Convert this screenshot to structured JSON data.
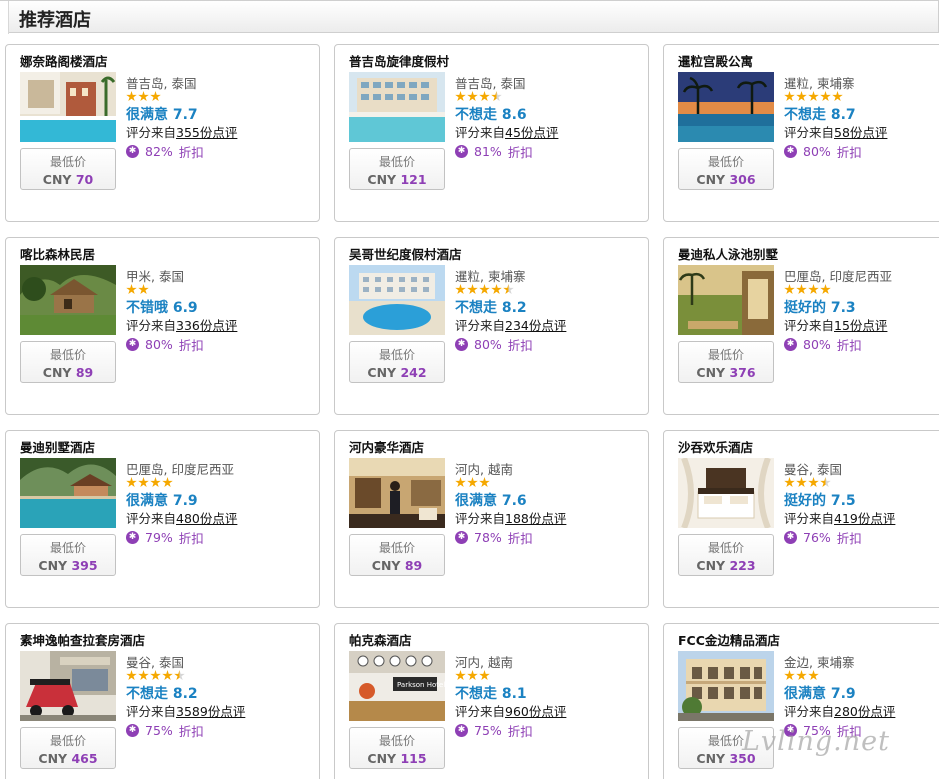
{
  "section": {
    "title": "推荐酒店"
  },
  "labels": {
    "review_prefix": "评分来自",
    "price_label": "最低价",
    "currency": "CNY",
    "discount_suffix": "折扣"
  },
  "colors": {
    "rating": "#1b82c2",
    "discount": "#8e3fb5",
    "star": "#f5a800"
  },
  "hotels": [
    {
      "name": "娜奈路阁楼酒店",
      "location": "普吉岛, 泰国",
      "stars": 3,
      "rating_text": "很满意",
      "rating": "7.7",
      "reviews": "355份点评",
      "discount": "82%",
      "price": "70",
      "image": "pool-resort"
    },
    {
      "name": "普吉岛旋律度假村",
      "location": "普吉岛, 泰国",
      "stars": 3.5,
      "rating_text": "不想走",
      "rating": "8.6",
      "reviews": "45份点评",
      "discount": "81%",
      "price": "121",
      "image": "hotel-pool"
    },
    {
      "name": "暹粒宫殿公寓",
      "location": "暹粒, 柬埔寨",
      "stars": 5,
      "rating_text": "不想走",
      "rating": "8.7",
      "reviews": "58份点评",
      "discount": "80%",
      "price": "306",
      "image": "palm-pool-night"
    },
    {
      "name": "喀比森林民居",
      "location": "甲米, 泰国",
      "stars": 2,
      "rating_text": "不错哦",
      "rating": "6.9",
      "reviews": "336份点评",
      "discount": "80%",
      "price": "89",
      "image": "forest-house"
    },
    {
      "name": "吴哥世纪度假村酒店",
      "location": "暹粒, 柬埔寨",
      "stars": 4.5,
      "rating_text": "不想走",
      "rating": "8.2",
      "reviews": "234份点评",
      "discount": "80%",
      "price": "242",
      "image": "round-pool"
    },
    {
      "name": "曼迪私人泳池别墅",
      "location": "巴厘岛, 印度尼西亚",
      "stars": 4,
      "rating_text": "挺好的",
      "rating": "7.3",
      "reviews": "15份点评",
      "discount": "80%",
      "price": "376",
      "image": "villa-field"
    },
    {
      "name": "曼迪别墅酒店",
      "location": "巴厘岛, 印度尼西亚",
      "stars": 4,
      "rating_text": "很满意",
      "rating": "7.9",
      "reviews": "480份点评",
      "discount": "79%",
      "price": "395",
      "image": "villa-pool"
    },
    {
      "name": "河内豪华酒店",
      "location": "河内, 越南",
      "stars": 3,
      "rating_text": "很满意",
      "rating": "7.6",
      "reviews": "188份点评",
      "discount": "78%",
      "price": "89",
      "image": "lobby"
    },
    {
      "name": "沙吞欢乐酒店",
      "location": "曼谷, 泰国",
      "stars": 3.5,
      "rating_text": "挺好的",
      "rating": "7.5",
      "reviews": "419份点评",
      "discount": "76%",
      "price": "223",
      "image": "bedroom"
    },
    {
      "name": "素坤逸帕查拉套房酒店",
      "location": "曼谷, 泰国",
      "stars": 4.5,
      "rating_text": "不想走",
      "rating": "8.2",
      "reviews": "3589份点评",
      "discount": "75%",
      "price": "465",
      "image": "tuktuk"
    },
    {
      "name": "帕克森酒店",
      "location": "河内, 越南",
      "stars": 3,
      "rating_text": "不想走",
      "rating": "8.1",
      "reviews": "960份点评",
      "discount": "75%",
      "price": "115",
      "image": "reception"
    },
    {
      "name": "FCC金边精品酒店",
      "location": "金边, 柬埔寨",
      "stars": 3,
      "rating_text": "很满意",
      "rating": "7.9",
      "reviews": "280份点评",
      "discount": "75%",
      "price": "350",
      "image": "colonial-building"
    }
  ],
  "watermark": "Lvling.net"
}
